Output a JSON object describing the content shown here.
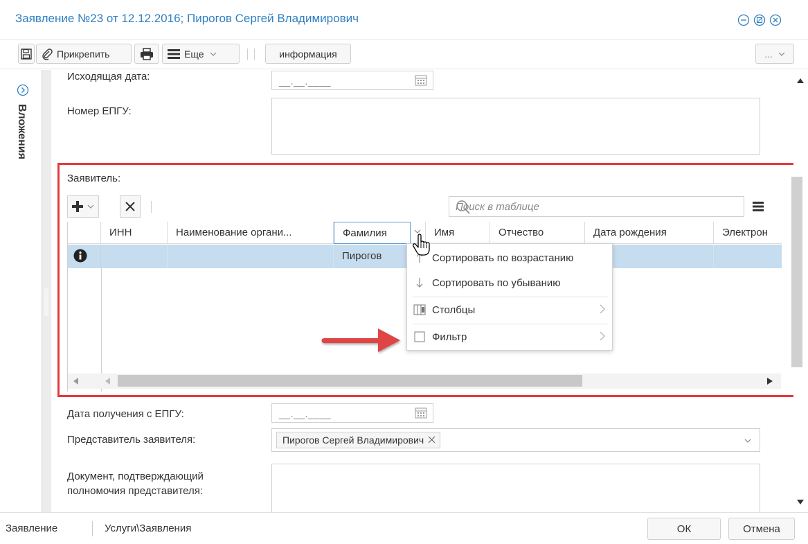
{
  "window": {
    "title": "Заявление №23 от 12.12.2016; Пирогов Сергей Владимирович"
  },
  "toolbar": {
    "attach_label": "Прикрепить",
    "more_label": "Еще",
    "info_label": "информация",
    "overflow_label": "..."
  },
  "sidebar": {
    "label": "Вложения"
  },
  "form": {
    "outgoing_date_label": "Исходящая дата:",
    "outgoing_date_mask": "__.__.____",
    "epgu_number_label": "Номер ЕПГУ:",
    "applicant_label": "Заявитель:",
    "received_date_label": "Дата получения с ЕПГУ:",
    "received_date_mask": "__.__.____",
    "representative_label": "Представитель заявителя:",
    "representative_tag": "Пирогов Сергей Владимирович",
    "document_label_line1": "Документ, подтверждающий",
    "document_label_line2": "полномочия представителя:"
  },
  "grid": {
    "search_placeholder": "Поиск в таблице",
    "columns": [
      "ИНН",
      "Наименование органи...",
      "Фамилия",
      "Имя",
      "Отчество",
      "Дата рождения",
      "Электрон"
    ],
    "rows": [
      {
        "inn": "",
        "org": "",
        "surname": "Пирогов",
        "name": "",
        "patronymic": "",
        "birth": "",
        "email": ""
      }
    ]
  },
  "context_menu": {
    "items": [
      {
        "label": "Сортировать по возрастанию",
        "icon": "sort-asc-icon"
      },
      {
        "label": "Сортировать по убыванию",
        "icon": "sort-desc-icon"
      },
      {
        "label": "Столбцы",
        "icon": "columns-icon"
      },
      {
        "label": "Фильтр",
        "icon": "checkbox-icon"
      }
    ]
  },
  "statusbar": {
    "item1": "Заявление",
    "item2": "Услуги\\Заявления"
  },
  "buttons": {
    "ok": "ОК",
    "cancel": "Отмена"
  },
  "colors": {
    "title": "#2f7fc1",
    "highlight": "#e53a3a",
    "selected_row": "#c6dcef",
    "arrow": "#e04545"
  }
}
